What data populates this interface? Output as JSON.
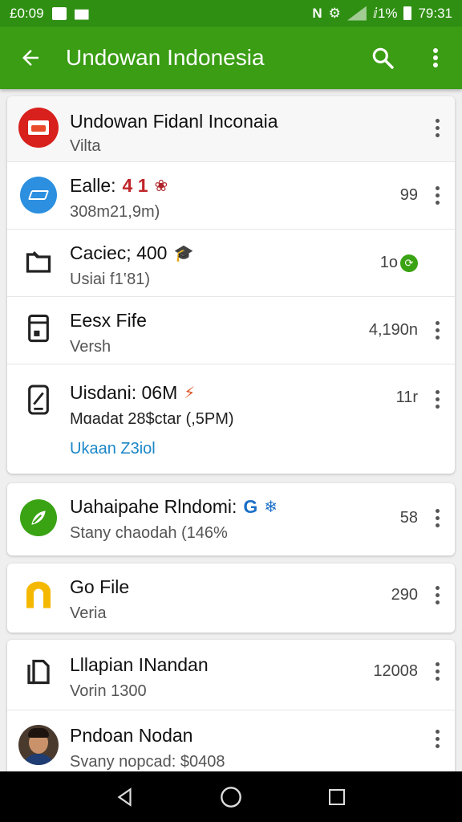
{
  "status_bar": {
    "time_left": "£0:09",
    "battery_text": "ⅈ1%",
    "time_right": "79:31"
  },
  "app_bar": {
    "title": "Undowan Indonesia",
    "back_icon": "arrow-left-icon",
    "search_icon": "search-icon",
    "more_icon": "more-vert-icon"
  },
  "colors": {
    "status_bar": "#2f8f12",
    "app_bar": "#3a9d14",
    "link_blue": "#1b86c7",
    "nav_bar": "#000000"
  },
  "items": [
    {
      "title": "Undowan Fidanl Inconaia",
      "subtitle": "Vilta",
      "meta": "",
      "icon": "red-brand-logo-icon"
    },
    {
      "title": "Ealle:",
      "title_extra": "4 1",
      "emoji": "❀",
      "subtitle": "308m21,9m)",
      "meta": "99",
      "icon": "blue-circle-icon"
    },
    {
      "title": "Caciec; 400",
      "emoji": "🎓",
      "subtitle": "Usiai f1‛81)",
      "meta": "1o",
      "icon": "folder-icon"
    },
    {
      "title": "Eesx Fife",
      "subtitle": "Versh",
      "meta": "4,190n",
      "icon": "document-icon"
    },
    {
      "title": "Uisdani: 06M",
      "emoji": "⚡",
      "subtitle": "Mɑadat 28$ctar (,5PM)",
      "link": "Ukaan Z3iol",
      "meta": "11r",
      "icon": "phone-doc-icon"
    },
    {
      "title": "Uahaipahe Rlndomi:",
      "title_extra": "G",
      "emoji": "❄",
      "subtitle": "Stany chaodah (146%",
      "meta": "58",
      "icon": "green-leaf-icon"
    },
    {
      "title": "Go File",
      "subtitle": "Veria",
      "meta": "290",
      "icon": "yellow-arch-icon"
    },
    {
      "title": "Lllapian INandan",
      "subtitle": "Vorin 1300",
      "meta": "12008",
      "icon": "files-icon"
    },
    {
      "title": "Pndoan Nodan",
      "subtitle": "Svany nopcad: $0408",
      "meta": "",
      "icon": "avatar"
    }
  ],
  "nav": {
    "back": "nav-back-icon",
    "home": "nav-home-icon",
    "recents": "nav-recents-icon"
  }
}
